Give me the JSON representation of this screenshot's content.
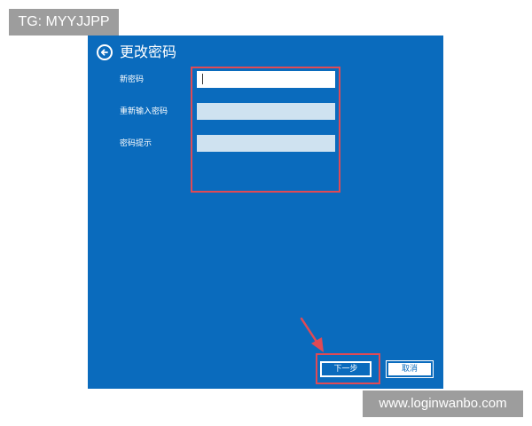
{
  "watermarks": {
    "top_left": "TG: MYYJJPP",
    "bottom_right": "www.loginwanbo.com"
  },
  "dialog": {
    "title": "更改密码",
    "back_icon": "back-arrow-circle-icon",
    "fields": [
      {
        "label": "新密码",
        "value": "",
        "state": "focused"
      },
      {
        "label": "重新输入密码",
        "value": "",
        "state": "inactive"
      },
      {
        "label": "密码提示",
        "value": "",
        "state": "inactive"
      }
    ],
    "buttons": {
      "next_label": "下一步",
      "cancel_label": "取消"
    }
  },
  "colors": {
    "dialog_background": "#0a6bbd",
    "annotation_red": "#e04a55",
    "watermark_gray": "#9d9d9d"
  }
}
